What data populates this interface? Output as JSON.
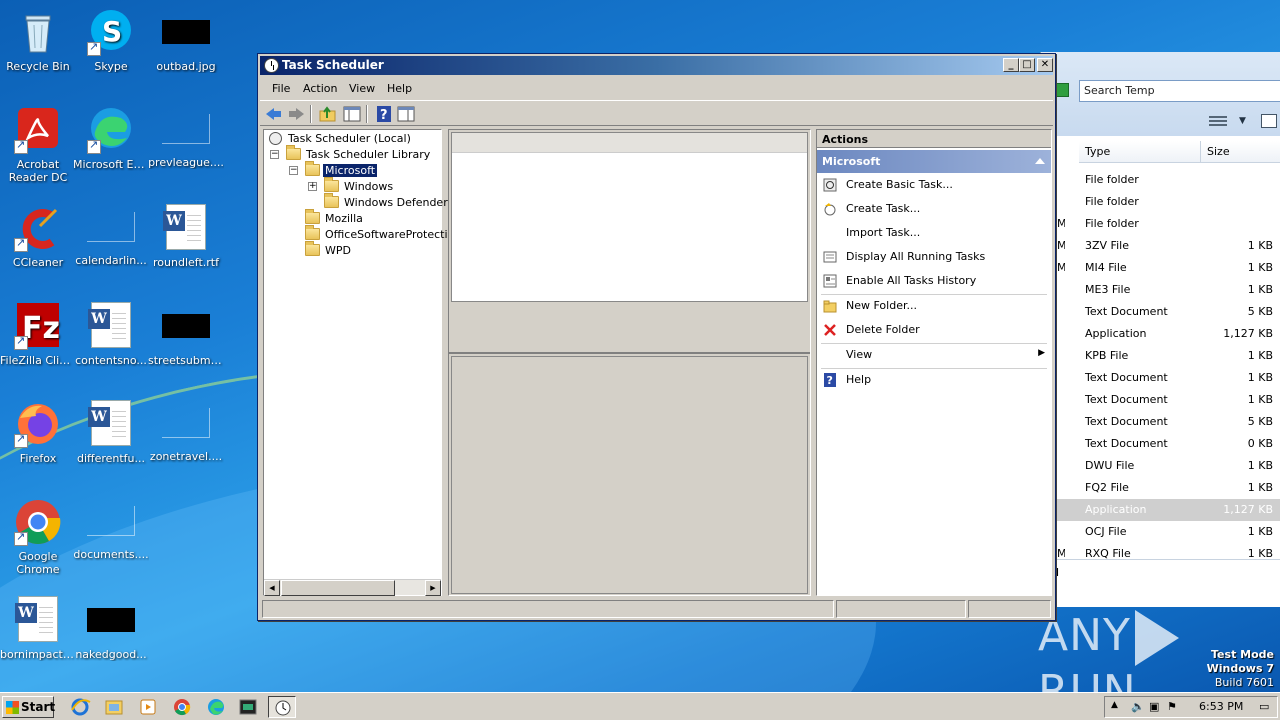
{
  "desktop": {
    "icons": [
      {
        "label": "Recycle Bin"
      },
      {
        "label": "Skype"
      },
      {
        "label": "outbad.jpg"
      },
      {
        "label": "Acrobat Reader DC"
      },
      {
        "label": "Microsoft Edge"
      },
      {
        "label": "prevleague...."
      },
      {
        "label": "CCleaner"
      },
      {
        "label": "calendarlin..."
      },
      {
        "label": "roundleft.rtf"
      },
      {
        "label": "FileZilla Client"
      },
      {
        "label": "contentsno..."
      },
      {
        "label": "streetsubmi..."
      },
      {
        "label": "Firefox"
      },
      {
        "label": "differentfu..."
      },
      {
        "label": "zonetravel...."
      },
      {
        "label": "Google Chrome"
      },
      {
        "label": "documents...."
      },
      {
        "label": "bornimpact.rtf"
      },
      {
        "label": "nakedgood..."
      }
    ]
  },
  "explorer": {
    "search_placeholder": "Search Temp",
    "columns": {
      "type": "Type",
      "size": "Size"
    },
    "rows": [
      {
        "date": "",
        "type": "File folder",
        "size": ""
      },
      {
        "date": "",
        "type": "File folder",
        "size": ""
      },
      {
        "date": "M",
        "type": "File folder",
        "size": ""
      },
      {
        "date": "M",
        "type": "3ZV File",
        "size": "1 KB"
      },
      {
        "date": "M",
        "type": "MI4 File",
        "size": "1 KB"
      },
      {
        "date": "",
        "type": "ME3 File",
        "size": "1 KB"
      },
      {
        "date": "",
        "type": "Text Document",
        "size": "5 KB"
      },
      {
        "date": "",
        "type": "Application",
        "size": "1,127 KB"
      },
      {
        "date": "",
        "type": "KPB File",
        "size": "1 KB"
      },
      {
        "date": "",
        "type": "Text Document",
        "size": "1 KB"
      },
      {
        "date": "",
        "type": "Text Document",
        "size": "1 KB"
      },
      {
        "date": "",
        "type": "Text Document",
        "size": "5 KB"
      },
      {
        "date": "",
        "type": "Text Document",
        "size": "0 KB"
      },
      {
        "date": "",
        "type": "DWU File",
        "size": "1 KB"
      },
      {
        "date": "",
        "type": "FQ2 File",
        "size": "1 KB"
      },
      {
        "date": "",
        "type": "Application",
        "size": "1,127 KB"
      },
      {
        "date": "",
        "type": "OCJ File",
        "size": "1 KB"
      },
      {
        "date": "M",
        "type": "RXQ File",
        "size": "1 KB"
      }
    ],
    "details_text": "PM"
  },
  "task_scheduler": {
    "title": "Task Scheduler",
    "menu": [
      "File",
      "Action",
      "View",
      "Help"
    ],
    "tree": {
      "root": "Task Scheduler (Local)",
      "library": "Task Scheduler Library",
      "microsoft": "Microsoft",
      "windows": "Windows",
      "windows_defender": "Windows Defender",
      "mozilla": "Mozilla",
      "office": "OfficeSoftwareProtectio",
      "wpd": "WPD"
    },
    "actions": {
      "header": "Actions",
      "section": "Microsoft",
      "items": [
        "Create Basic Task...",
        "Create Task...",
        "Import Task...",
        "Display All Running Tasks",
        "Enable All Tasks History",
        "New Folder...",
        "Delete Folder",
        "View",
        "Help"
      ]
    }
  },
  "watermark": {
    "text_left": "ANY",
    "text_right": "RUN"
  },
  "test_mode": {
    "line1": "Test Mode",
    "line2": "Windows 7",
    "line3": "Build 7601"
  },
  "taskbar": {
    "start_label": "Start",
    "clock": "6:53 PM"
  },
  "colors": {
    "title_bar": "#0a246a",
    "selection": "#0a246a",
    "actions_section": "#6c88c0"
  }
}
